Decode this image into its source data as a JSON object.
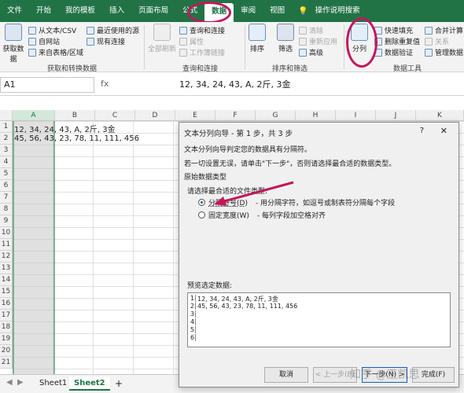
{
  "menu": {
    "tabs": [
      "文件",
      "开始",
      "我的模板",
      "插入",
      "页面布局",
      "公式",
      "数据",
      "审阅",
      "视图"
    ],
    "active": "数据",
    "tell_me": "操作说明搜索"
  },
  "ribbon": {
    "get_data": "获取数据",
    "from_text": "从文本/CSV",
    "from_web": "自网站",
    "from_table": "来自表格/区域",
    "recent": "最近使用的源",
    "existing": "现有连接",
    "group1": "获取和转换数据",
    "refresh_all": "全部刷新",
    "queries": "查询和连接",
    "properties": "属性",
    "edit_links": "工作簿链接",
    "group2": "查询和连接",
    "sort": "排序",
    "filter": "筛选",
    "clear": "清除",
    "reapply": "重新应用",
    "advanced": "高级",
    "group3": "排序和筛选",
    "text_to_columns": "分列",
    "flash_fill": "快速填充",
    "remove_dup": "删除重复值",
    "validation": "数据验证",
    "consolidate": "合并计算",
    "relations": "关系",
    "manage_model": "管理数据",
    "group4": "数据工具"
  },
  "formula_bar": {
    "name_box": "A1",
    "fx": "fx",
    "value": "12, 34, 24, 43, A, 2斤, 3金"
  },
  "grid": {
    "columns": [
      "A",
      "B",
      "C",
      "D",
      "E",
      "F",
      "G",
      "H",
      "I",
      "J",
      "K"
    ],
    "rows": [
      "1",
      "2",
      "3",
      "4",
      "5",
      "6",
      "7",
      "8",
      "9",
      "10",
      "11",
      "12",
      "13",
      "14",
      "15",
      "16",
      "17",
      "18",
      "19",
      "20",
      "21"
    ],
    "cells": {
      "A1": "12, 34, 24, 43, A, 2斤, 3金",
      "A2": "45, 56, 43, 23, 78, 11, 111, 456"
    }
  },
  "sheets": {
    "tabs": [
      "Sheet1",
      "Sheet2"
    ],
    "active": "Sheet2",
    "add": "+"
  },
  "dialog": {
    "title": "文本分列向导 - 第 1 步，共 3 步",
    "help": "?",
    "close": "✕",
    "line1": "文本分列向导判定您的数据具有分隔符。",
    "line2": "若一切设置无误，请单击\"下一步\"，否则请选择最合适的数据类型。",
    "section": "原始数据类型",
    "choose": "请选择最合适的文件类型:",
    "opt1_label": "分隔符号(D)",
    "opt1_desc": "- 用分隔字符，如逗号或制表符分隔每个字段",
    "opt2_label": "固定宽度(W)",
    "opt2_desc": "- 每列字段加空格对齐",
    "preview_label": "预览选定数据:",
    "preview_rows": [
      {
        "n": "1",
        "text": "12, 34, 24, 43, A, 2斤, 3金"
      },
      {
        "n": "2",
        "text": "45, 56, 43, 23, 78, 11, 111, 456"
      },
      {
        "n": "3",
        "text": ""
      },
      {
        "n": "4",
        "text": ""
      },
      {
        "n": "5",
        "text": ""
      },
      {
        "n": "6",
        "text": ""
      }
    ],
    "cancel": "取消",
    "back": "< 上一步(B)",
    "next": "下一步(N) >",
    "finish": "完成(F)"
  },
  "watermark": "知乎 @王凯思"
}
